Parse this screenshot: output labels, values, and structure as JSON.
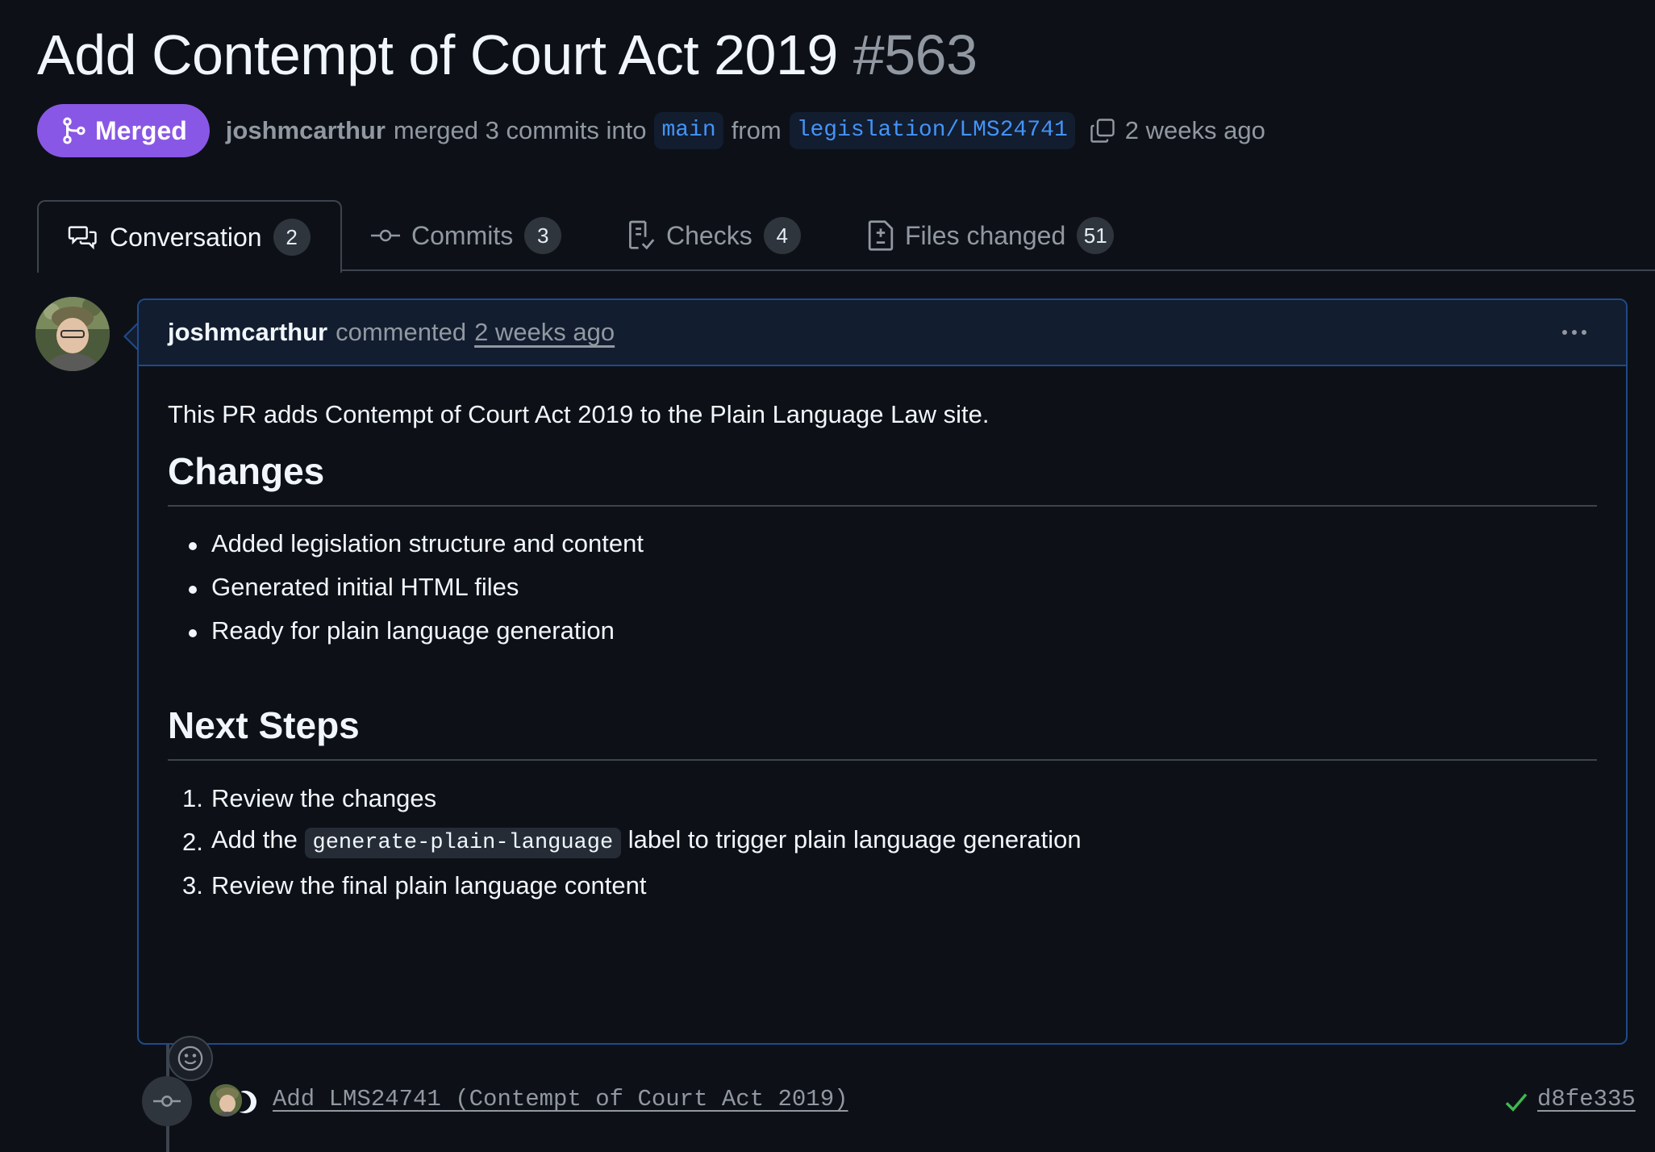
{
  "pr": {
    "title": "Add Contempt of Court Act 2019",
    "number": "#563",
    "status": "Merged",
    "author": "joshmcarthur",
    "merged_text": "merged 3 commits into",
    "base_branch": "main",
    "from_text": "from",
    "head_branch": "legislation/LMS24741",
    "time": "2 weeks ago"
  },
  "tabs": [
    {
      "label": "Conversation",
      "count": "2",
      "icon": "comment-discussion-icon"
    },
    {
      "label": "Commits",
      "count": "3",
      "icon": "git-commit-icon"
    },
    {
      "label": "Checks",
      "count": "4",
      "icon": "checklist-icon"
    },
    {
      "label": "Files changed",
      "count": "51",
      "icon": "file-diff-icon"
    }
  ],
  "comment": {
    "author": "joshmcarthur",
    "action": "commented",
    "time": "2 weeks ago",
    "intro": "This PR adds Contempt of Court Act 2019 to the Plain Language Law site.",
    "changes_heading": "Changes",
    "changes": [
      "Added legislation structure and content",
      "Generated initial HTML files",
      "Ready for plain language generation"
    ],
    "next_heading": "Next Steps",
    "steps": {
      "s1": "Review the changes",
      "s2_prefix": "Add the",
      "s2_code": "generate-plain-language",
      "s2_suffix": "label to trigger plain language generation",
      "s3": "Review the final plain language content"
    },
    "step_numbers": [
      "1.",
      "2.",
      "3."
    ]
  },
  "commit": {
    "message": "Add LMS24741 (Contempt of Court Act 2019)",
    "sha": "d8fe335",
    "status_color": "#3fb950"
  },
  "colors": {
    "background": "#0d1117",
    "merged": "#8957e5",
    "link": "#4493f8",
    "comment_border": "#1f4a8a"
  }
}
